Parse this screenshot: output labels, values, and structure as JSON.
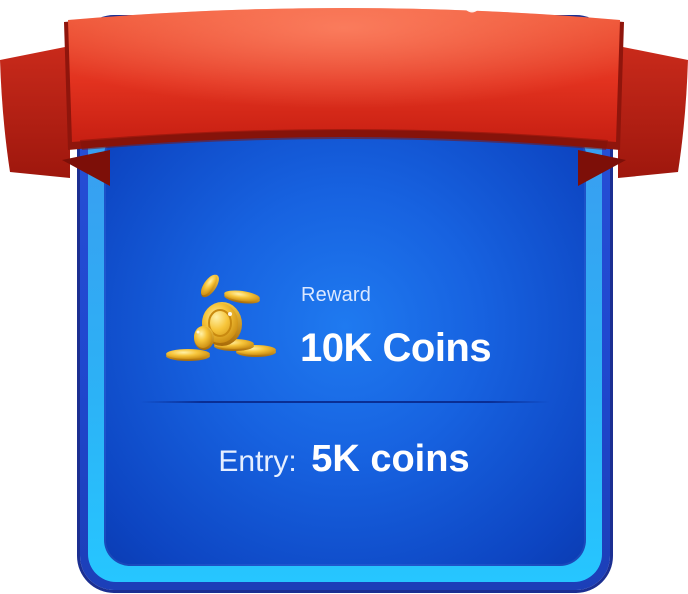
{
  "reward": {
    "label": "Reward",
    "value": "10K Coins",
    "icon": "gold-coins-icon"
  },
  "entry": {
    "label": "Entry:",
    "value": "5K coins"
  },
  "colors": {
    "ribbon": "#e2321f",
    "ribbon_dark": "#a8190f",
    "panel": "#1762e0",
    "rim": "#2db0f5",
    "frame": "#1f48cf",
    "coin": "#f5b82a"
  }
}
